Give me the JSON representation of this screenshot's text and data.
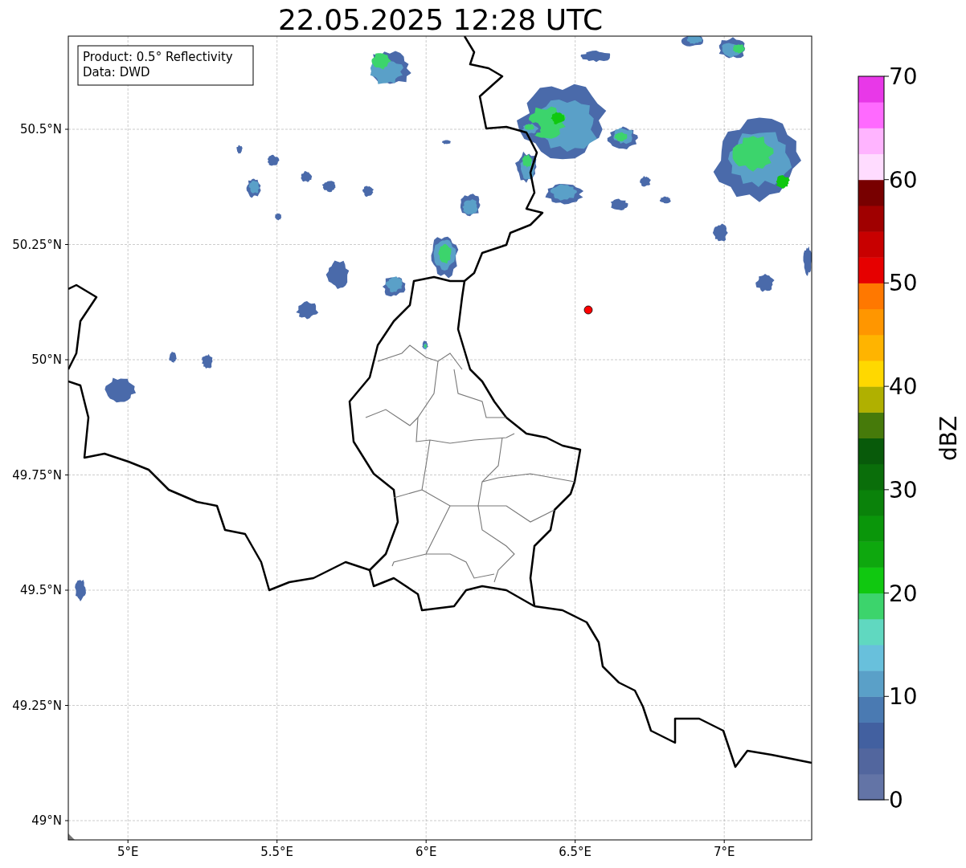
{
  "title": "22.05.2025 12:28 UTC",
  "legend": [
    "Product: 0.5° Reflectivity",
    "Data: DWD"
  ],
  "map": {
    "xticks": [
      "5°E",
      "5.5°E",
      "6°E",
      "6.5°E",
      "7°E"
    ],
    "yticks": [
      "50.5°N",
      "50.25°N",
      "50°N",
      "49.75°N",
      "49.5°N",
      "49.25°N",
      "49°N"
    ]
  },
  "colorbar": {
    "label": "dBZ",
    "ticks": [
      "70",
      "60",
      "50",
      "40",
      "30",
      "20",
      "10",
      "0"
    ],
    "segments": [
      {
        "color": "#6374a6"
      },
      {
        "color": "#52669e"
      },
      {
        "color": "#4260a0"
      },
      {
        "color": "#4a7ab2"
      },
      {
        "color": "#5aa0c8"
      },
      {
        "color": "#68c0dc"
      },
      {
        "color": "#60d8c0"
      },
      {
        "color": "#3cd46c"
      },
      {
        "color": "#10c810"
      },
      {
        "color": "#0ea80e"
      },
      {
        "color": "#0a960a"
      },
      {
        "color": "#0a820a"
      },
      {
        "color": "#0a6e0a"
      },
      {
        "color": "#085a0a"
      },
      {
        "color": "#467a0a"
      },
      {
        "color": "#b0b000"
      },
      {
        "color": "#ffd800"
      },
      {
        "color": "#ffb400"
      },
      {
        "color": "#ff9600"
      },
      {
        "color": "#ff7800"
      },
      {
        "color": "#e60000"
      },
      {
        "color": "#c80000"
      },
      {
        "color": "#a00000"
      },
      {
        "color": "#780000"
      },
      {
        "color": "#ffdcff"
      },
      {
        "color": "#ffb4ff"
      },
      {
        "color": "#ff6aff"
      },
      {
        "color": "#e838e8"
      }
    ]
  }
}
